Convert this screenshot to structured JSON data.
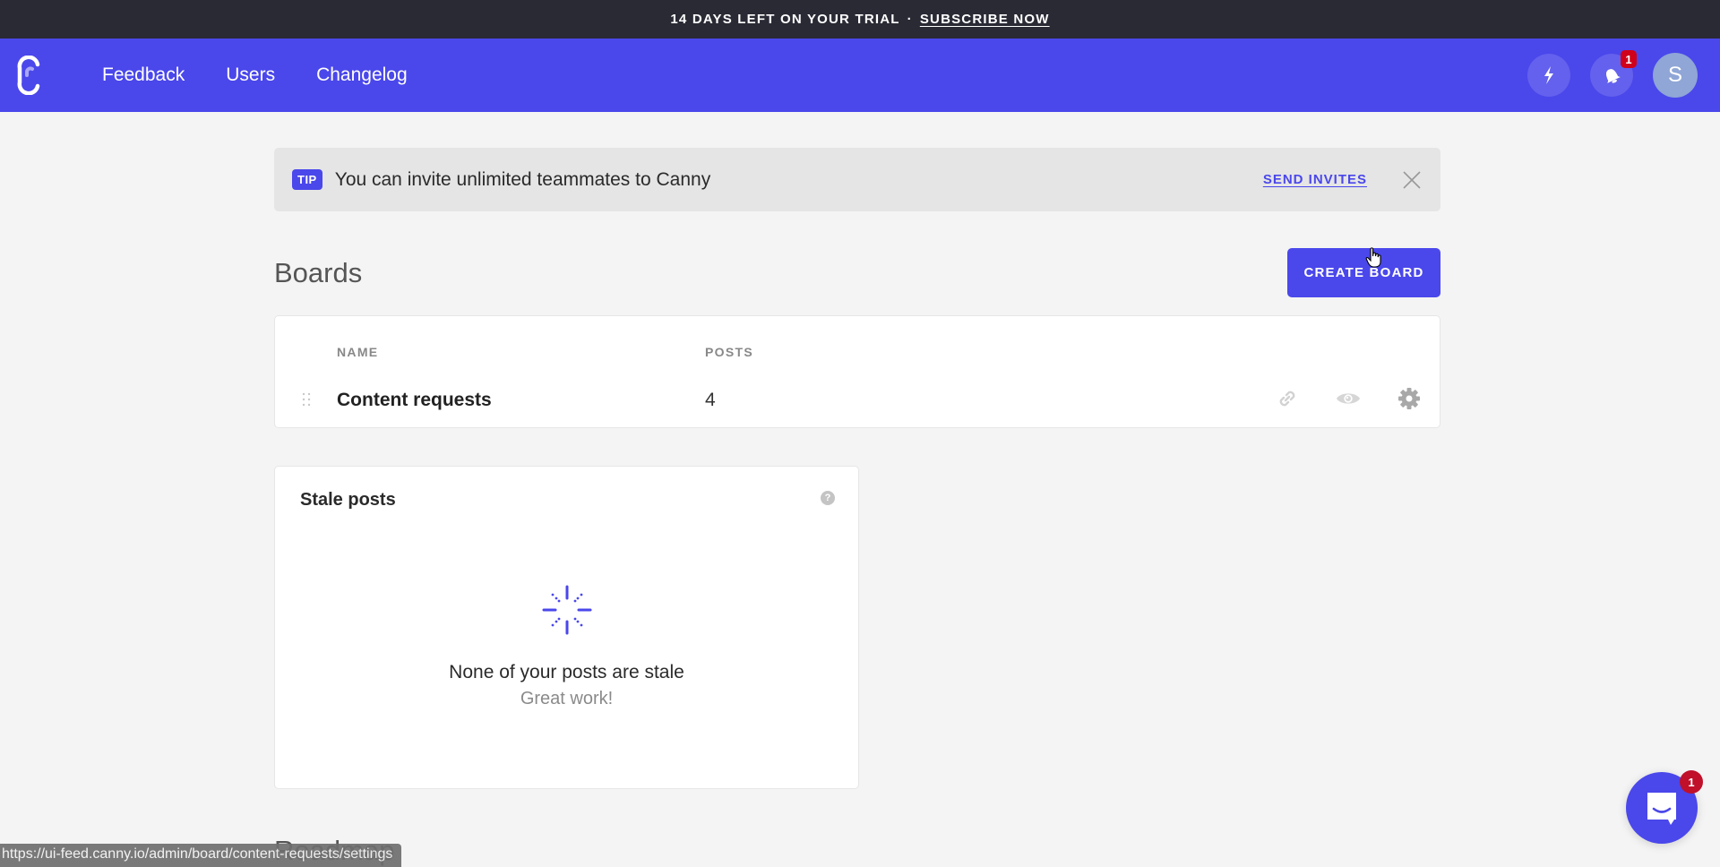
{
  "trial_banner": {
    "text": "14 DAYS LEFT ON YOUR TRIAL",
    "separator": "·",
    "link_label": "SUBSCRIBE NOW"
  },
  "nav": {
    "logo_icon": "canny-logo-icon",
    "links": [
      {
        "label": "Feedback"
      },
      {
        "label": "Users"
      },
      {
        "label": "Changelog"
      }
    ],
    "actions": {
      "lightning_icon": "lightning-icon",
      "notifications_icon": "bell-icon",
      "notifications_count": "1",
      "avatar_initial": "S"
    }
  },
  "tip": {
    "badge": "TIP",
    "text": "You can invite unlimited teammates to Canny",
    "link_label": "SEND INVITES",
    "close_icon": "close-icon"
  },
  "boards": {
    "title": "Boards",
    "create_button": "CREATE BOARD",
    "columns": {
      "name": "NAME",
      "posts": "POSTS"
    },
    "rows": [
      {
        "name": "Content requests",
        "posts": "4",
        "icons": [
          "link-icon",
          "eye-icon",
          "gear-icon"
        ]
      }
    ]
  },
  "stale_posts": {
    "title": "Stale posts",
    "help_icon": "?",
    "empty_title": "None of your posts are stale",
    "empty_subtitle": "Great work!"
  },
  "roadmap": {
    "title": "Roadmap"
  },
  "status_bar": {
    "url": "https://ui-feed.canny.io/admin/board/content-requests/settings"
  },
  "chat_widget": {
    "badge_count": "1"
  },
  "colors": {
    "brand": "#4a47eb",
    "trial_bar": "#2a2a35",
    "badge_red": "#d0021b",
    "page_bg": "#f4f4f4"
  }
}
